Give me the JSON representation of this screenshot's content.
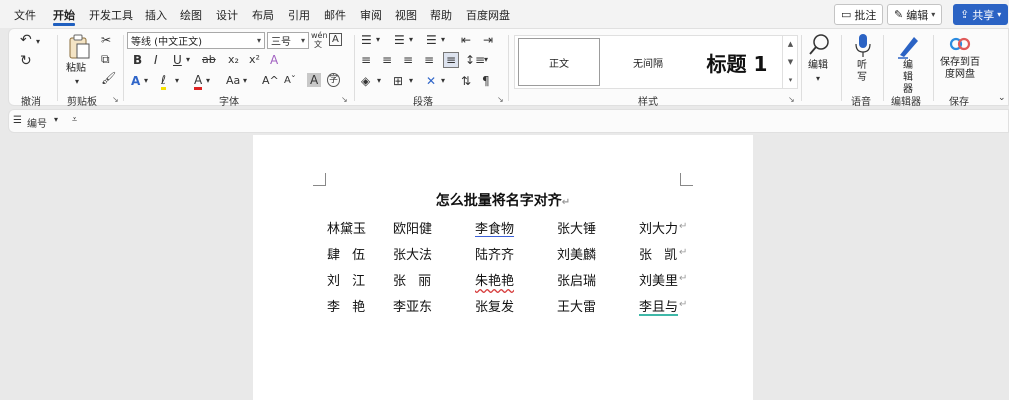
{
  "tabs": [
    "文件",
    "开始",
    "开发工具",
    "插入",
    "绘图",
    "设计",
    "布局",
    "引用",
    "邮件",
    "审阅",
    "视图",
    "帮助",
    "百度网盘"
  ],
  "active_tab": "开始",
  "top_buttons": {
    "comment": "批注",
    "edit": "编辑",
    "share": "共享"
  },
  "ribbon": {
    "undo_group": "撤消",
    "clipboard": {
      "label": "剪贴板",
      "paste": "粘贴"
    },
    "font": {
      "label": "字体",
      "name": "等线 (中文正文)",
      "size": "三号",
      "wen": "wén 文",
      "a_box": "A",
      "bold": "B",
      "italic": "I",
      "underline": "U",
      "strike": "ab",
      "sub": "x₂",
      "sup": "x²",
      "clear": "A",
      "text_effect": "A",
      "highlight": "ℓ",
      "font_color": "A",
      "case": "Aa",
      "grow": "A^",
      "shrink": "Aˇ",
      "shade": "A",
      "enclose": "字"
    },
    "paragraph": {
      "label": "段落"
    },
    "styles": {
      "label": "样式",
      "items": [
        "正文",
        "无间隔",
        "标题 1"
      ]
    },
    "editing": "编辑",
    "voice": {
      "label": "语音",
      "button": "听写"
    },
    "editor": {
      "label": "编辑器",
      "button": "编辑器"
    },
    "save": {
      "label": "保存",
      "button": "保存到百度网盘"
    }
  },
  "quickbar": {
    "numbering": "编号"
  },
  "document": {
    "title": "怎么批量将名字对齐",
    "rows": [
      [
        "林黛玉",
        "欧阳健",
        "李食物",
        "张大锤",
        "刘大力"
      ],
      [
        "肆 伍",
        "张大法",
        "陆齐齐",
        "刘美麟",
        "张 凯"
      ],
      [
        "刘 江",
        "张 丽",
        "朱艳艳",
        "张启瑞",
        "刘美里"
      ],
      [
        "李 艳",
        "李亚东",
        "张复发",
        "王大雷",
        "李且与"
      ]
    ]
  },
  "colors": {
    "accent": "#1f5fbf",
    "share_bg": "#2b63c4",
    "spell_red": "#d63a3a",
    "grammar_blue": "#3a5fd6",
    "smart_green": "#3fb8a8"
  }
}
